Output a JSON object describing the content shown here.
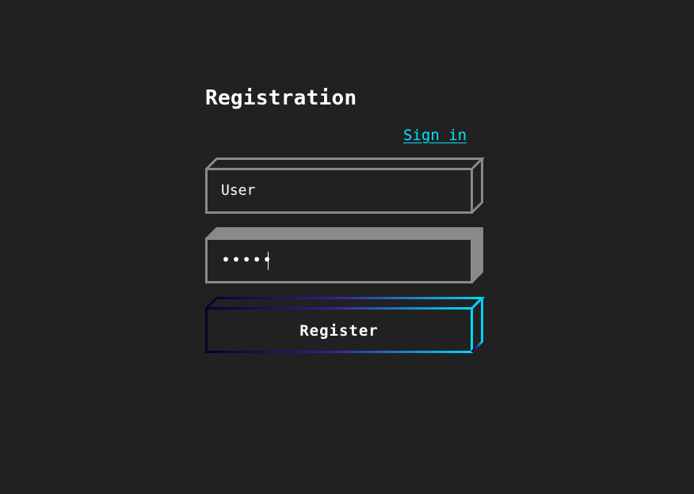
{
  "form": {
    "title": "Registration",
    "signin_link": "Sign in",
    "username": {
      "value": "User",
      "placeholder": "User"
    },
    "password": {
      "value": "•••••"
    },
    "register_label": "Register"
  },
  "colors": {
    "background": "#212121",
    "field_border": "#8a8a8a",
    "link": "#00e5ff",
    "button_gradient_start": "#08002a",
    "button_gradient_mid": "#3a1a8a",
    "button_gradient_end": "#00d8ff"
  }
}
